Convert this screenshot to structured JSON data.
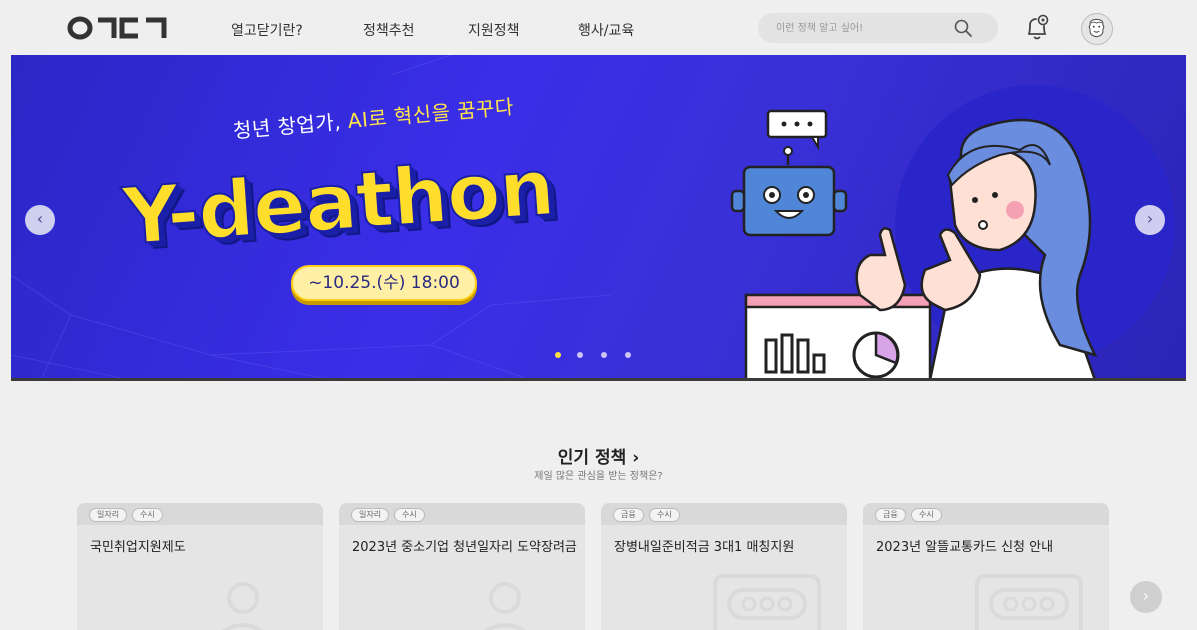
{
  "header": {
    "logo_text": "ㅇㄱㄷㄱ",
    "nav": [
      "열고닫기란?",
      "정책추천",
      "지원정책",
      "행사/교육"
    ],
    "search_placeholder": "이런 정책 알고 싶어!",
    "icons": {
      "search": "search-icon",
      "notification": "bell-icon",
      "profile": "avatar-icon"
    }
  },
  "banner": {
    "tagline_prefix": "청년 창업가, ",
    "tagline_highlight": "AI로 혁신을 꿈꾸다",
    "title": "Y-deathon",
    "date": "~10.25.(수) 18:00",
    "prev_label": "‹",
    "next_label": "›",
    "slide_count": 4,
    "active_slide": 1,
    "colors": {
      "background": "#3a2ee8",
      "title": "#ffde2b",
      "accent_circle": "#2a25c9"
    }
  },
  "popular": {
    "title": "인기 정책 ›",
    "subtitle": "제일 많은 관심을 받는 정책은?",
    "next_label": "›",
    "cards": [
      {
        "tags": [
          "일자리",
          "수시"
        ],
        "title": "국민취업지원제도"
      },
      {
        "tags": [
          "일자리",
          "수시"
        ],
        "title": "2023년 중소기업 청년일자리 도약장려금"
      },
      {
        "tags": [
          "금융",
          "수시"
        ],
        "title": "장병내일준비적금 3대1 매칭지원"
      },
      {
        "tags": [
          "금융",
          "수시"
        ],
        "title": "2023년 알뜰교통카드 신청 안내"
      }
    ]
  }
}
